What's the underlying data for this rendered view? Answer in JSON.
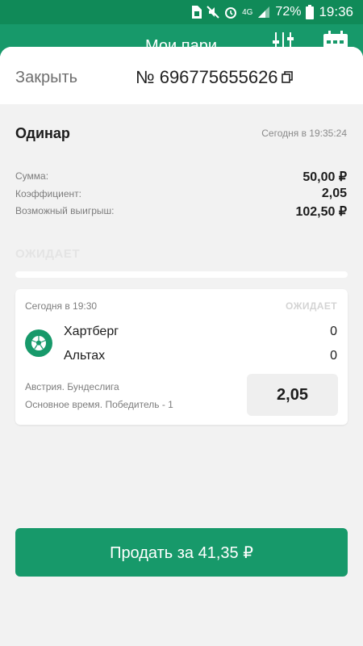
{
  "status_bar": {
    "battery_percent": "72%",
    "network": "4G",
    "time": "19:36",
    "icons": [
      "sim-icon",
      "mute-icon",
      "alarm-icon",
      "network-4g-icon",
      "signal-icon",
      "battery-icon"
    ]
  },
  "app_bar": {
    "title": "Мои пари",
    "icons": [
      "filter-icon",
      "calendar-icon"
    ]
  },
  "sheet": {
    "close_label": "Закрыть",
    "bet_number": "№ 696775655626",
    "copy_icon": "copy-icon"
  },
  "bet": {
    "type": "Одинар",
    "timestamp": "Сегодня в 19:35:24",
    "rows": [
      {
        "label": "Сумма:",
        "value": "50,00 ₽"
      },
      {
        "label": "Коэффициент:",
        "value": "2,05"
      },
      {
        "label": "Возможный выигрыш:",
        "value": "102,50 ₽"
      }
    ],
    "status": "ОЖИДАЕТ"
  },
  "event": {
    "time": "Сегодня в 19:30",
    "status": "ОЖИДАЕТ",
    "sport_icon": "soccer-ball-icon",
    "teams": [
      {
        "name": "Хартберг",
        "score": "0"
      },
      {
        "name": "Альтах",
        "score": "0"
      }
    ],
    "league": "Австрия. Бундеслига",
    "market": "Основное время. Победитель - 1",
    "odds": "2,05"
  },
  "actions": {
    "sell_label": "Продать за 41,35 ₽"
  },
  "colors": {
    "brand_green": "#17996a",
    "status_bar_green": "#108a58",
    "background": "#f2f2f2"
  }
}
